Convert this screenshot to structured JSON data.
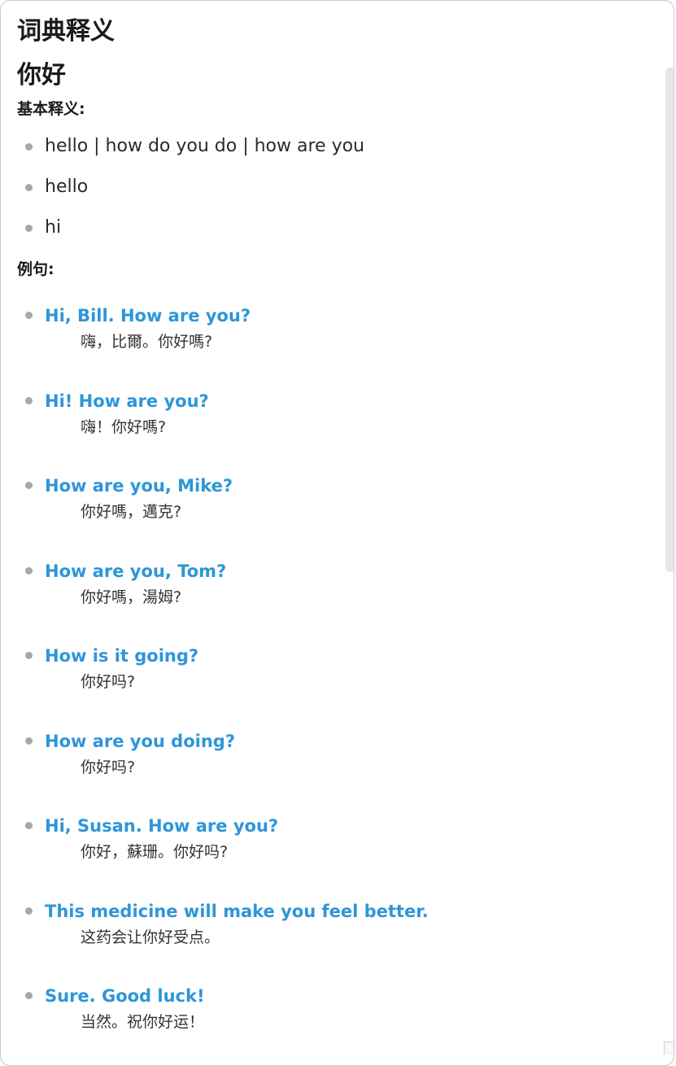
{
  "panel": {
    "title": "词典释义",
    "word": "你好"
  },
  "basic": {
    "label": "基本释义:",
    "definitions": [
      "hello | how do you do | how are you",
      "hello",
      "hi"
    ]
  },
  "examples": {
    "label": "例句:",
    "items": [
      {
        "en": "Hi, Bill. How are you?",
        "zh": "嗨，比爾。你好嗎?"
      },
      {
        "en": "Hi! How are you?",
        "zh": "嗨！你好嗎?"
      },
      {
        "en": "How are you, Mike?",
        "zh": "你好嗎，邁克?"
      },
      {
        "en": "How are you, Tom?",
        "zh": "你好嗎，湯姆?"
      },
      {
        "en": "How is it going?",
        "zh": "你好吗?"
      },
      {
        "en": "How are you doing?",
        "zh": "你好吗?"
      },
      {
        "en": "Hi, Susan. How are you?",
        "zh": "你好，蘇珊。你好吗?"
      },
      {
        "en": "This medicine will make you feel better.",
        "zh": "这药会让你好受点。"
      },
      {
        "en": "Sure. Good luck!",
        "zh": "当然。祝你好运！"
      }
    ]
  },
  "colors": {
    "accent": "#2d96d8",
    "bullet": "#a8a8a8",
    "text": "#222222"
  }
}
